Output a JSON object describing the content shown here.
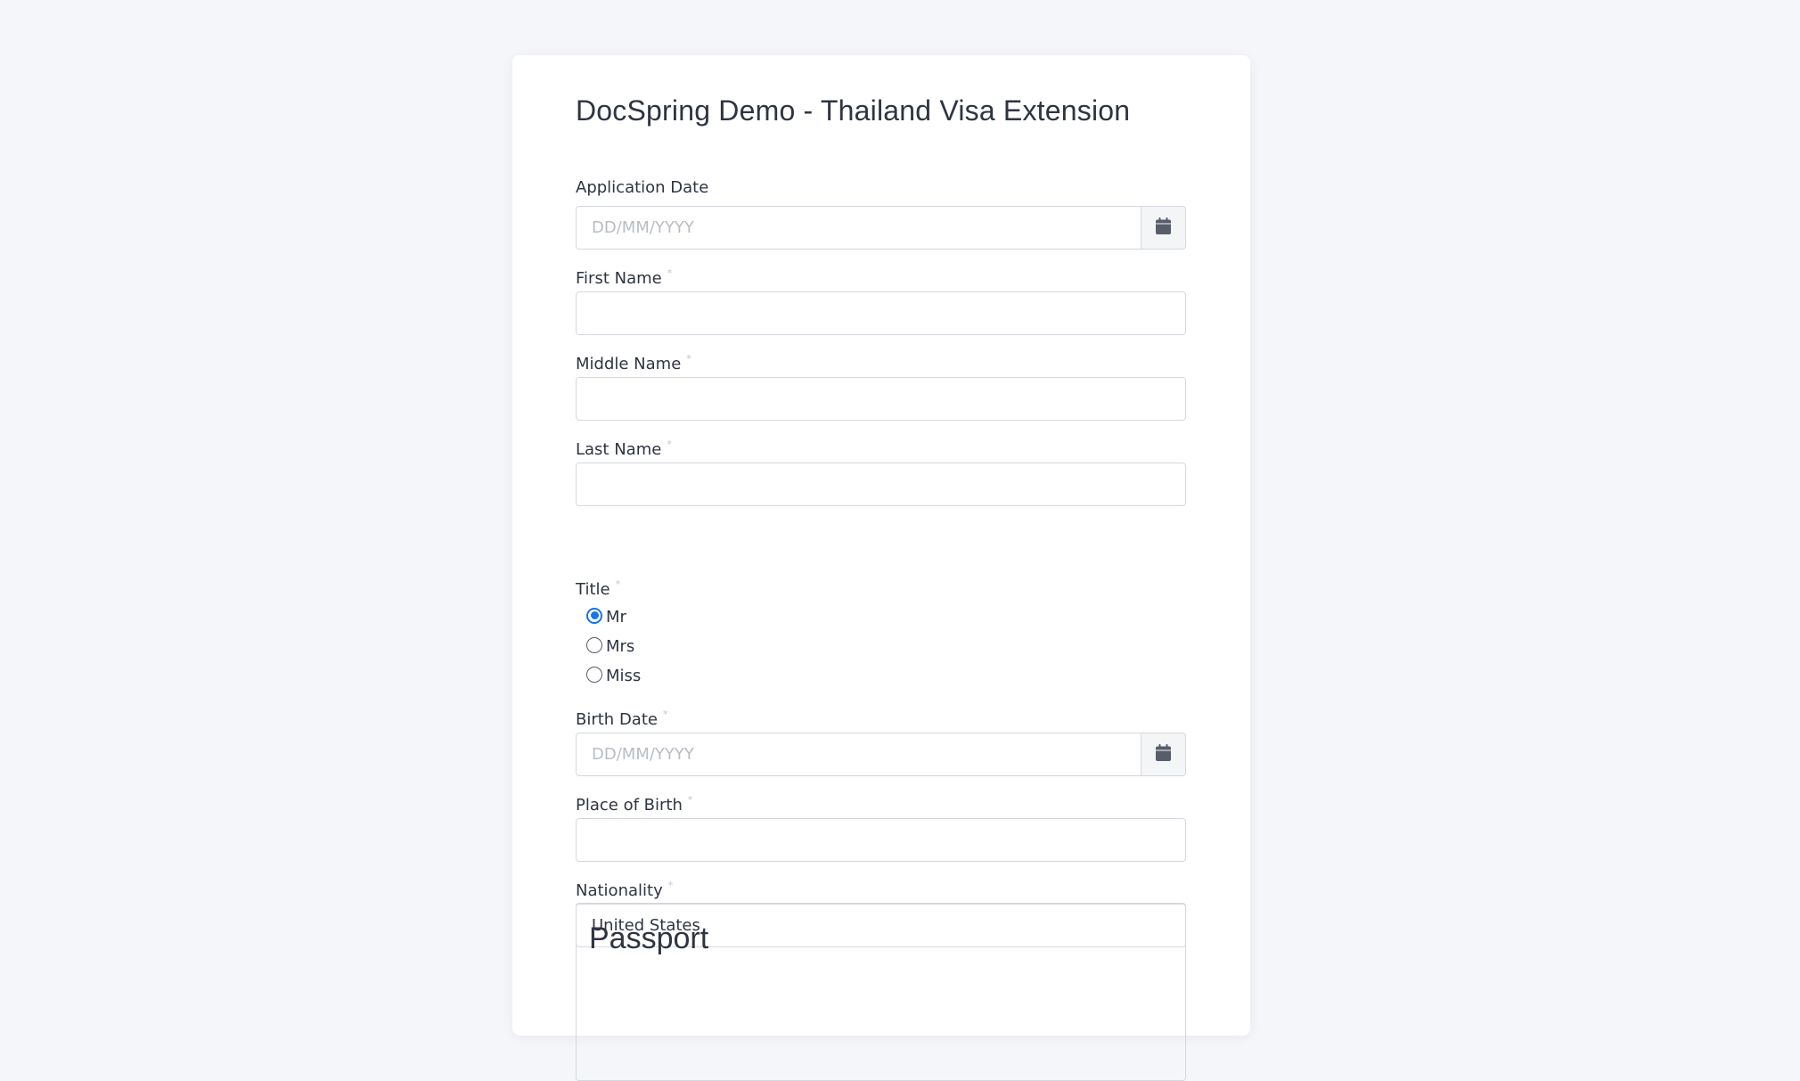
{
  "form": {
    "title": "DocSpring Demo - Thailand Visa Extension",
    "required_marker": "*",
    "fields": {
      "application_date": {
        "label": "Application Date",
        "placeholder": "DD/MM/YYYY",
        "value": ""
      },
      "first_name": {
        "label": "First Name",
        "value": ""
      },
      "middle_name": {
        "label": "Middle Name",
        "value": ""
      },
      "last_name": {
        "label": "Last Name",
        "value": ""
      },
      "title": {
        "label": "Title",
        "options": [
          "Mr",
          "Mrs",
          "Miss"
        ],
        "selected": "Mr"
      },
      "birth_date": {
        "label": "Birth Date",
        "placeholder": "DD/MM/YYYY",
        "value": ""
      },
      "place_of_birth": {
        "label": "Place of Birth",
        "value": ""
      },
      "nationality": {
        "label": "Nationality",
        "value": "United States"
      }
    },
    "sections": {
      "passport": {
        "title": "Passport"
      }
    }
  },
  "icons": {
    "date_picker": "calendar-icon"
  },
  "colors": {
    "page_background": "#f5f6f9",
    "card_background": "#ffffff",
    "text": "#2f3442",
    "placeholder": "#b8bcc4",
    "border": "#d5d8de",
    "required_marker": "#c2c5cc",
    "radio_accent": "#1a73e8"
  }
}
